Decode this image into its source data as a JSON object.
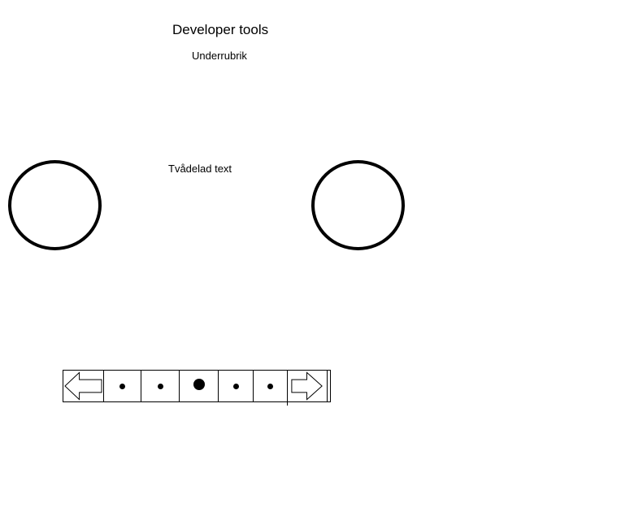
{
  "header": {
    "title": "Developer tools",
    "subtitle": "Underrubrik"
  },
  "content": {
    "text": "Tvådelad text"
  },
  "carousel": {
    "prev_icon": "arrow-left-icon",
    "next_icon": "arrow-right-icon",
    "dot_count": 5,
    "active_index": 2
  }
}
